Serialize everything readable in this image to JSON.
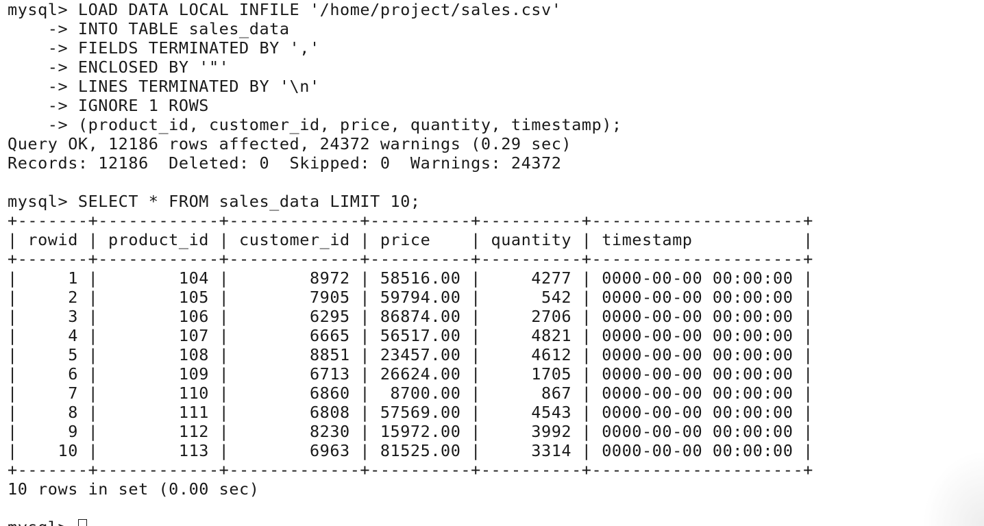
{
  "terminal": {
    "load_command": [
      "mysql> LOAD DATA LOCAL INFILE '/home/project/sales.csv'",
      "    -> INTO TABLE sales_data",
      "    -> FIELDS TERMINATED BY ','",
      "    -> ENCLOSED BY '\"'",
      "    -> LINES TERMINATED BY '\\n'",
      "    -> IGNORE 1 ROWS",
      "    -> (product_id, customer_id, price, quantity, timestamp);"
    ],
    "query_result": "Query OK, 12186 rows affected, 24372 warnings (0.29 sec)",
    "records_summary": "Records: 12186  Deleted: 0  Skipped: 0  Warnings: 24372",
    "select_command": "mysql> SELECT * FROM sales_data LIMIT 10;",
    "table_border": "+-------+------------+-------------+----------+----------+---------------------+",
    "table_header": "| rowid | product_id | customer_id | price    | quantity | timestamp           |",
    "table_rows": [
      "|     1 |        104 |        8972 | 58516.00 |     4277 | 0000-00-00 00:00:00 |",
      "|     2 |        105 |        7905 | 59794.00 |      542 | 0000-00-00 00:00:00 |",
      "|     3 |        106 |        6295 | 86874.00 |     2706 | 0000-00-00 00:00:00 |",
      "|     4 |        107 |        6665 | 56517.00 |     4821 | 0000-00-00 00:00:00 |",
      "|     5 |        108 |        8851 | 23457.00 |     4612 | 0000-00-00 00:00:00 |",
      "|     6 |        109 |        6713 | 26624.00 |     1705 | 0000-00-00 00:00:00 |",
      "|     7 |        110 |        6860 |  8700.00 |      867 | 0000-00-00 00:00:00 |",
      "|     8 |        111 |        6808 | 57569.00 |     4543 | 0000-00-00 00:00:00 |",
      "|     9 |        112 |        8230 | 15972.00 |     3992 | 0000-00-00 00:00:00 |",
      "|    10 |        113 |        6963 | 81525.00 |     3314 | 0000-00-00 00:00:00 |"
    ],
    "rows_in_set": "10 rows in set (0.00 sec)",
    "prompt": "mysql> "
  }
}
